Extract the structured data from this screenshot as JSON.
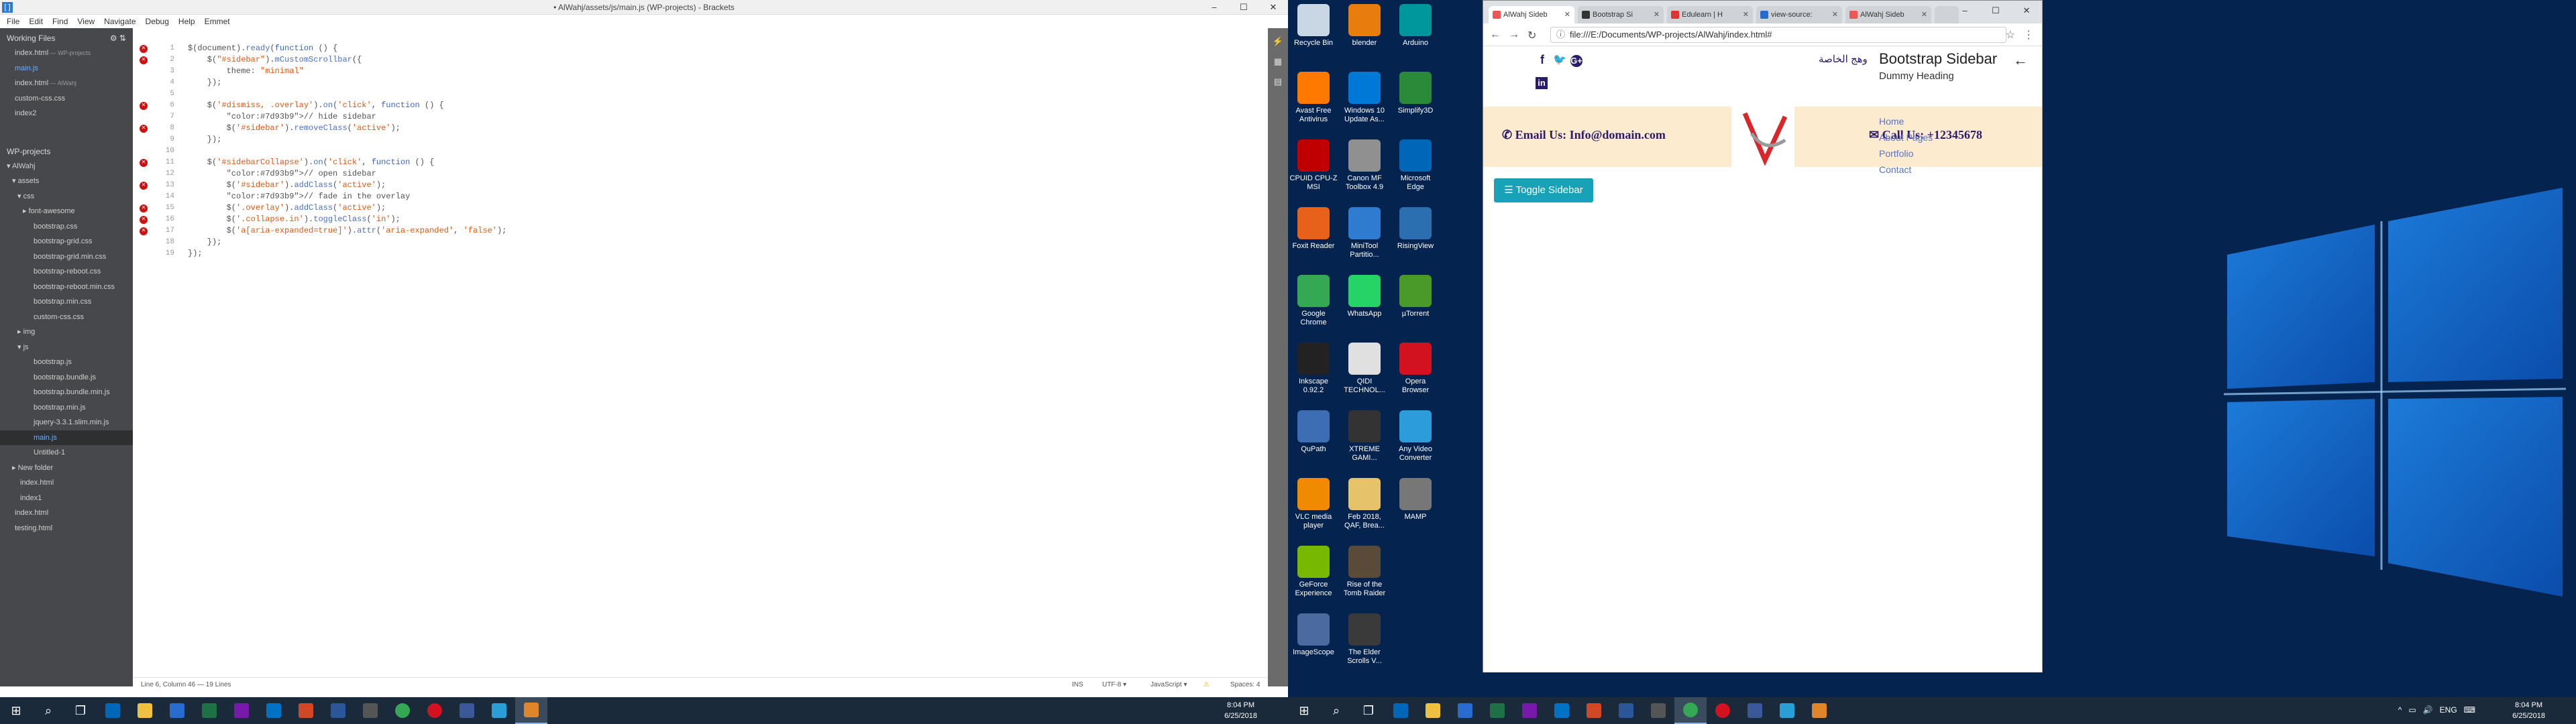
{
  "brackets": {
    "title": "• AlWahj/assets/js/main.js (WP-projects) - Brackets",
    "menu": [
      "File",
      "Edit",
      "Find",
      "View",
      "Navigate",
      "Debug",
      "Help",
      "Emmet"
    ],
    "working_files_title": "Working Files",
    "working_files": [
      {
        "name": "index.html",
        "sub": "— WP-projects"
      },
      {
        "name": "main.js",
        "sub": ""
      },
      {
        "name": "index.html",
        "sub": "— AlWahj"
      },
      {
        "name": "custom-css.css",
        "sub": ""
      },
      {
        "name": "index2",
        "sub": ""
      }
    ],
    "project_title": "WP-projects",
    "tree": [
      {
        "name": "▾ AlWahj",
        "indent": 10
      },
      {
        "name": "▾ assets",
        "indent": 18
      },
      {
        "name": "▾ css",
        "indent": 26
      },
      {
        "name": "▸ font-awesome",
        "indent": 34
      },
      {
        "name": "bootstrap.css",
        "indent": 50
      },
      {
        "name": "bootstrap-grid.css",
        "indent": 50
      },
      {
        "name": "bootstrap-grid.min.css",
        "indent": 50
      },
      {
        "name": "bootstrap-reboot.css",
        "indent": 50
      },
      {
        "name": "bootstrap-reboot.min.css",
        "indent": 50
      },
      {
        "name": "bootstrap.min.css",
        "indent": 50
      },
      {
        "name": "custom-css.css",
        "indent": 50
      },
      {
        "name": "▸ img",
        "indent": 26
      },
      {
        "name": "▾ js",
        "indent": 26
      },
      {
        "name": "bootstrap.js",
        "indent": 50
      },
      {
        "name": "bootstrap.bundle.js",
        "indent": 50
      },
      {
        "name": "bootstrap.bundle.min.js",
        "indent": 50
      },
      {
        "name": "bootstrap.min.js",
        "indent": 50
      },
      {
        "name": "jquery-3.3.1.slim.min.js",
        "indent": 50
      },
      {
        "name": "main.js",
        "indent": 50
      },
      {
        "name": "Untitled-1",
        "indent": 50
      },
      {
        "name": "▸ New folder",
        "indent": 18
      },
      {
        "name": "index.html",
        "indent": 30
      },
      {
        "name": "index1",
        "indent": 30
      },
      {
        "name": "index.html",
        "indent": 22
      },
      {
        "name": "testing.html",
        "indent": 22
      }
    ],
    "code_lines": [
      "$(document).ready(function () {",
      "    $(\"#sidebar\").mCustomScrollbar({",
      "        theme: \"minimal\"",
      "    });",
      "",
      "    $('#dismiss, .overlay').on('click', function () {",
      "        // hide sidebar",
      "        $('#sidebar').removeClass('active');",
      "    });",
      "",
      "    $('#sidebarCollapse').on('click', function () {",
      "        // open sidebar",
      "        $('#sidebar').addClass('active');",
      "        // fade in the overlay",
      "        $('.overlay').addClass('active');",
      "        $('.collapse.in').toggleClass('in');",
      "        $('a[aria-expanded=true]').attr('aria-expanded', 'false');",
      "    });",
      "});"
    ],
    "error_lines": [
      1,
      2,
      6,
      8,
      11,
      13,
      15,
      16,
      17
    ],
    "status": {
      "position": "Line 6, Column 46 — 19 Lines",
      "ins": "INS",
      "encoding": "UTF-8 ▾",
      "language": "JavaScript ▾",
      "spaces": "Spaces: 4"
    }
  },
  "taskbar": {
    "time": "8:04 PM",
    "date": "6/25/2018",
    "lang": "ENG"
  },
  "desktop_icons": [
    {
      "label": "Recycle Bin",
      "color": "#c9d6e3",
      "col": 0,
      "row": 0
    },
    {
      "label": "blender",
      "color": "#e87d0d",
      "col": 1,
      "row": 0
    },
    {
      "label": "Arduino",
      "color": "#00979c",
      "col": 2,
      "row": 0
    },
    {
      "label": "Avast Free Antivirus",
      "color": "#ff7800",
      "col": 0,
      "row": 1
    },
    {
      "label": "Windows 10 Update As...",
      "color": "#0078d7",
      "col": 1,
      "row": 1
    },
    {
      "label": "Simplify3D",
      "color": "#2a8a3a",
      "col": 2,
      "row": 1
    },
    {
      "label": "CPUID CPU-Z MSI",
      "color": "#c00000",
      "col": 0,
      "row": 2
    },
    {
      "label": "Canon MF Toolbox 4.9",
      "color": "#909090",
      "col": 1,
      "row": 2
    },
    {
      "label": "Microsoft Edge",
      "color": "#0067b8",
      "col": 2,
      "row": 2
    },
    {
      "label": "Foxit Reader",
      "color": "#e8611a",
      "col": 0,
      "row": 3
    },
    {
      "label": "MiniTool Partitio...",
      "color": "#2f7bd0",
      "col": 1,
      "row": 3
    },
    {
      "label": "RisingView",
      "color": "#2c6fb0",
      "col": 2,
      "row": 3
    },
    {
      "label": "Google Chrome",
      "color": "#34a853",
      "col": 0,
      "row": 4
    },
    {
      "label": "WhatsApp",
      "color": "#25d366",
      "col": 1,
      "row": 4
    },
    {
      "label": "µTorrent",
      "color": "#4a9a2a",
      "col": 2,
      "row": 4
    },
    {
      "label": "Inkscape 0.92.2",
      "color": "#222222",
      "col": 0,
      "row": 5
    },
    {
      "label": "QIDI TECHNOL...",
      "color": "#e0e0e0",
      "col": 1,
      "row": 5
    },
    {
      "label": "Opera Browser",
      "color": "#d3121f",
      "col": 2,
      "row": 5
    },
    {
      "label": "QuPath",
      "color": "#3d6db2",
      "col": 0,
      "row": 6
    },
    {
      "label": "XTREME GAMI...",
      "color": "#333333",
      "col": 1,
      "row": 6
    },
    {
      "label": "Any Video Converter",
      "color": "#2d9cdb",
      "col": 2,
      "row": 6
    },
    {
      "label": "VLC media player",
      "color": "#f08a00",
      "col": 0,
      "row": 7
    },
    {
      "label": "Feb 2018, QAF, Brea...",
      "color": "#e6c36a",
      "col": 1,
      "row": 7
    },
    {
      "label": "MAMP",
      "color": "#777777",
      "col": 2,
      "row": 7
    },
    {
      "label": "GeForce Experience",
      "color": "#76b900",
      "col": 0,
      "row": 8
    },
    {
      "label": "Rise of the Tomb Raider",
      "color": "#5a4a3a",
      "col": 1,
      "row": 8
    },
    {
      "label": "ImageScope",
      "color": "#4a6aa0",
      "col": 0,
      "row": 9
    },
    {
      "label": "The Elder Scrolls V...",
      "color": "#3a3a3a",
      "col": 1,
      "row": 9
    }
  ],
  "chrome": {
    "tabs": [
      "AlWahj Sideb",
      "Bootstrap Si",
      "Edulearn | H",
      "view-source:",
      "AlWahj Sideb"
    ],
    "url": "file:///E:/Documents/WP-projects/AlWahj/index.html#",
    "page": {
      "arabic": "وهج الخاصة",
      "sidebar_heading": "Bootstrap Sidebar",
      "dummy_heading": "Dummy Heading",
      "email": "Email Us: Info@domain.com",
      "phone": "Call Us: +12345678",
      "links": [
        "Home",
        "About Pages",
        "Portfolio",
        "Contact"
      ],
      "toggle": "Toggle Sidebar"
    }
  }
}
